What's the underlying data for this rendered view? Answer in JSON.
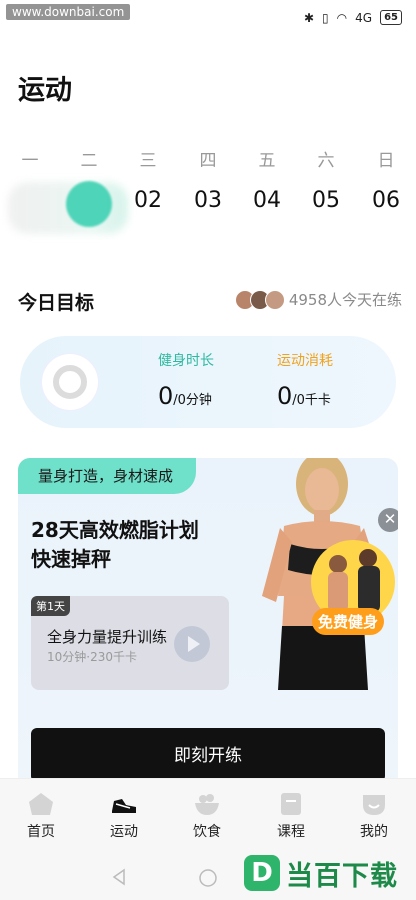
{
  "status_bar": {
    "watermark": "www.downbai.com",
    "battery": "65",
    "signal": "4G"
  },
  "page": {
    "title": "运动"
  },
  "week": {
    "weekdays": [
      "一",
      "二",
      "三",
      "四",
      "五",
      "六",
      "日"
    ],
    "dates": [
      "02",
      "03",
      "04",
      "05",
      "06"
    ]
  },
  "today_goal": {
    "title": "今日目标",
    "online_text": "4958人今天在练",
    "duration_label": "健身时长",
    "duration_value": "0",
    "duration_unit": "/0分钟",
    "calories_label": "运动消耗",
    "calories_value": "0",
    "calories_unit": "/0千卡"
  },
  "plan": {
    "tag": "量身打造，身材速成",
    "title_line1": "28天高效燃脂计划",
    "title_line2": "快速掉秤",
    "lesson_day": "第1天",
    "lesson_name": "全身力量提升训练",
    "lesson_meta": "10分钟·230千卡",
    "promo_label": "免费健身",
    "start_button": "即刻开练"
  },
  "nav": {
    "items": [
      {
        "label": "首页"
      },
      {
        "label": "运动"
      },
      {
        "label": "饮食"
      },
      {
        "label": "课程"
      },
      {
        "label": "我的"
      }
    ]
  },
  "brand": {
    "logo": "D",
    "text": "当百下载"
  },
  "colors": {
    "accent": "#3ed1b2",
    "duration": "#2fb9a0",
    "calories": "#f0a21f"
  }
}
